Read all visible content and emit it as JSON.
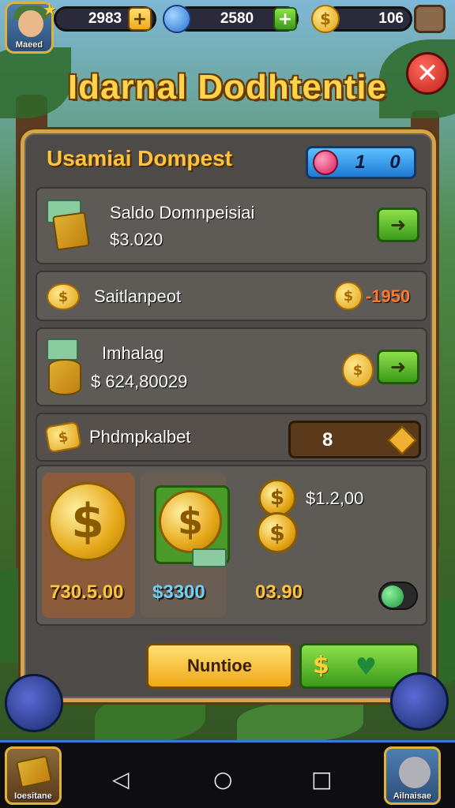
{
  "hud": {
    "player_name": "Maeed",
    "currency1": "2983",
    "currency2": "2580",
    "currency3": "106"
  },
  "title": "Idarnal Dodhtentie",
  "panel": {
    "title": "Usamiai Dompest",
    "gem_counter": {
      "left": "1",
      "right": "0"
    },
    "rows": [
      {
        "label": "Saldo Domnpeisiai",
        "value": "$3.020"
      },
      {
        "label": "Saitlanpeot",
        "value": "-1950"
      },
      {
        "label": "Imhalag",
        "value": "$ 624,80029"
      },
      {
        "label": "Phdmpkalbet",
        "value": "8"
      }
    ],
    "offers": [
      {
        "price": "730.5.00"
      },
      {
        "price": "$3300"
      },
      {
        "price": "03.90",
        "amount": "$1.2,00"
      }
    ],
    "action_button": "Nuntioe"
  },
  "corners": {
    "left_label": "Ioesitane",
    "right_label": "Ailnaisae"
  },
  "colors": {
    "accent_gold": "#ffc43a",
    "panel_bg": "#4e4a47",
    "green": "#3a9a1a",
    "red_value": "#ff7a2a"
  }
}
